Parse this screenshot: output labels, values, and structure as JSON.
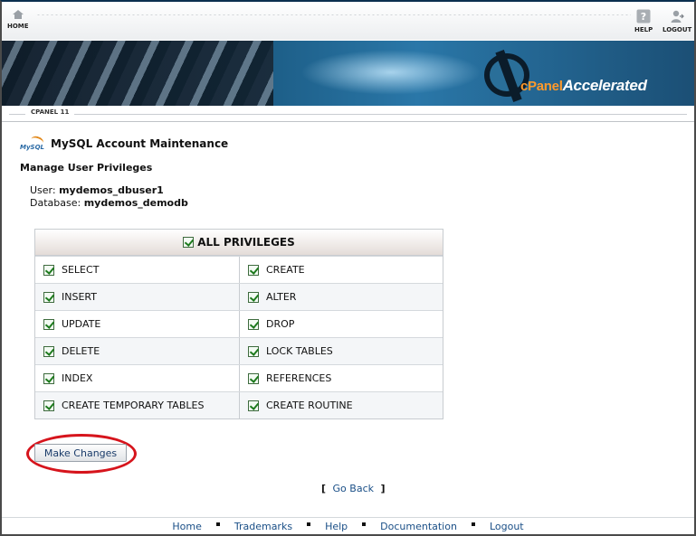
{
  "top_nav": {
    "home_label": "HOME",
    "help_label": "HELP",
    "logout_label": "LOGOUT"
  },
  "banner": {
    "brand_cpanel": "cPanel",
    "brand_accelerated": "Accelerated"
  },
  "breadcrumb": {
    "label": "CPANEL 11"
  },
  "page": {
    "logo_text": "MySQL",
    "title": "MySQL Account Maintenance",
    "subtitle": "Manage User Privileges",
    "user_label": "User:",
    "user_value": "mydemos_dbuser1",
    "database_label": "Database:",
    "database_value": "mydemos_demodb"
  },
  "privileges": {
    "all_label": "ALL PRIVILEGES",
    "all_checked": true,
    "items": [
      {
        "label": "SELECT",
        "checked": true
      },
      {
        "label": "CREATE",
        "checked": true
      },
      {
        "label": "INSERT",
        "checked": true
      },
      {
        "label": "ALTER",
        "checked": true
      },
      {
        "label": "UPDATE",
        "checked": true
      },
      {
        "label": "DROP",
        "checked": true
      },
      {
        "label": "DELETE",
        "checked": true
      },
      {
        "label": "LOCK TABLES",
        "checked": true
      },
      {
        "label": "INDEX",
        "checked": true
      },
      {
        "label": "REFERENCES",
        "checked": true
      },
      {
        "label": "CREATE TEMPORARY TABLES",
        "checked": true
      },
      {
        "label": "CREATE ROUTINE",
        "checked": true
      }
    ]
  },
  "actions": {
    "make_changes_label": "Make Changes",
    "go_back_open": "[",
    "go_back_label": "Go Back",
    "go_back_close": "]"
  },
  "footer": {
    "links": [
      "Home",
      "Trademarks",
      "Help",
      "Documentation",
      "Logout"
    ]
  },
  "colors": {
    "highlight_circle": "#d6141c",
    "link": "#1a4f87",
    "check": "#1d7a1d"
  }
}
